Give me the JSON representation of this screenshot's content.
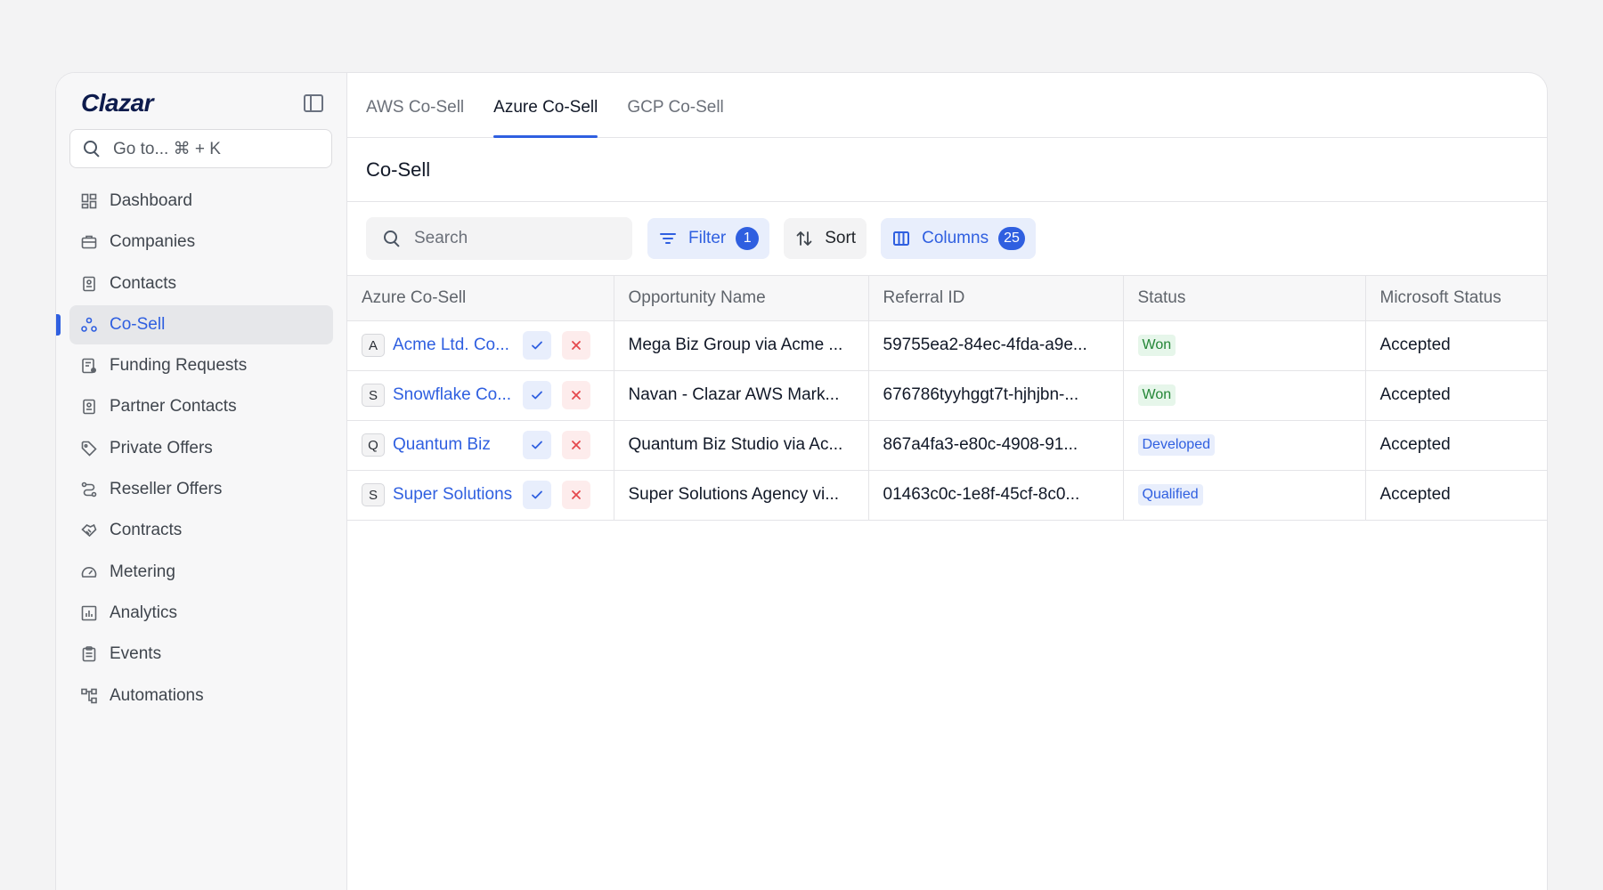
{
  "sidebar": {
    "logo": "Clazar",
    "goto_placeholder": "Go to... ⌘ + K",
    "items": [
      {
        "label": "Dashboard",
        "icon": "dashboard-icon"
      },
      {
        "label": "Companies",
        "icon": "briefcase-icon"
      },
      {
        "label": "Contacts",
        "icon": "contact-card-icon"
      },
      {
        "label": "Co-Sell",
        "icon": "co-sell-icon",
        "active": true
      },
      {
        "label": "Funding Requests",
        "icon": "funding-icon"
      },
      {
        "label": "Partner Contacts",
        "icon": "contact-card-icon"
      },
      {
        "label": "Private Offers",
        "icon": "tag-icon"
      },
      {
        "label": "Reseller Offers",
        "icon": "route-icon"
      },
      {
        "label": "Contracts",
        "icon": "handshake-icon"
      },
      {
        "label": "Metering",
        "icon": "gauge-icon"
      },
      {
        "label": "Analytics",
        "icon": "bar-chart-icon"
      },
      {
        "label": "Events",
        "icon": "clipboard-icon"
      },
      {
        "label": "Automations",
        "icon": "workflow-icon"
      }
    ]
  },
  "tabs": [
    {
      "label": "AWS Co-Sell"
    },
    {
      "label": "Azure Co-Sell",
      "active": true
    },
    {
      "label": "GCP Co-Sell"
    }
  ],
  "page_title": "Co-Sell",
  "toolbar": {
    "search_placeholder": "Search",
    "filter_label": "Filter",
    "filter_count": "1",
    "sort_label": "Sort",
    "columns_label": "Columns",
    "columns_count": "25"
  },
  "table": {
    "headers": [
      "Azure Co-Sell",
      "Opportunity Name",
      "Referral ID",
      "Status",
      "Microsoft Status"
    ],
    "rows": [
      {
        "initial": "A",
        "company": "Acme Ltd. Co...",
        "opportunity": "Mega Biz Group via Acme ...",
        "referral_id": "59755ea2-84ec-4fda-a9e...",
        "status": "Won",
        "ms_status": "Accepted"
      },
      {
        "initial": "S",
        "company": "Snowflake Co...",
        "opportunity": "Navan - Clazar AWS Mark...",
        "referral_id": "676786tyyhggt7t-hjhjbn-...",
        "status": "Won",
        "ms_status": "Accepted"
      },
      {
        "initial": "Q",
        "company": "Quantum Biz",
        "opportunity": "Quantum Biz Studio via Ac...",
        "referral_id": "867a4fa3-e80c-4908-91...",
        "status": "Developed",
        "ms_status": "Accepted"
      },
      {
        "initial": "S",
        "company": "Super Solutions",
        "opportunity": "Super Solutions Agency vi...",
        "referral_id": "01463c0c-1e8f-45cf-8c0...",
        "status": "Qualified",
        "ms_status": "Accepted"
      }
    ]
  },
  "colors": {
    "accent": "#2f5fe0",
    "won_bg": "#e6f6ea",
    "won_text": "#238636",
    "reject": "#e5484d"
  }
}
